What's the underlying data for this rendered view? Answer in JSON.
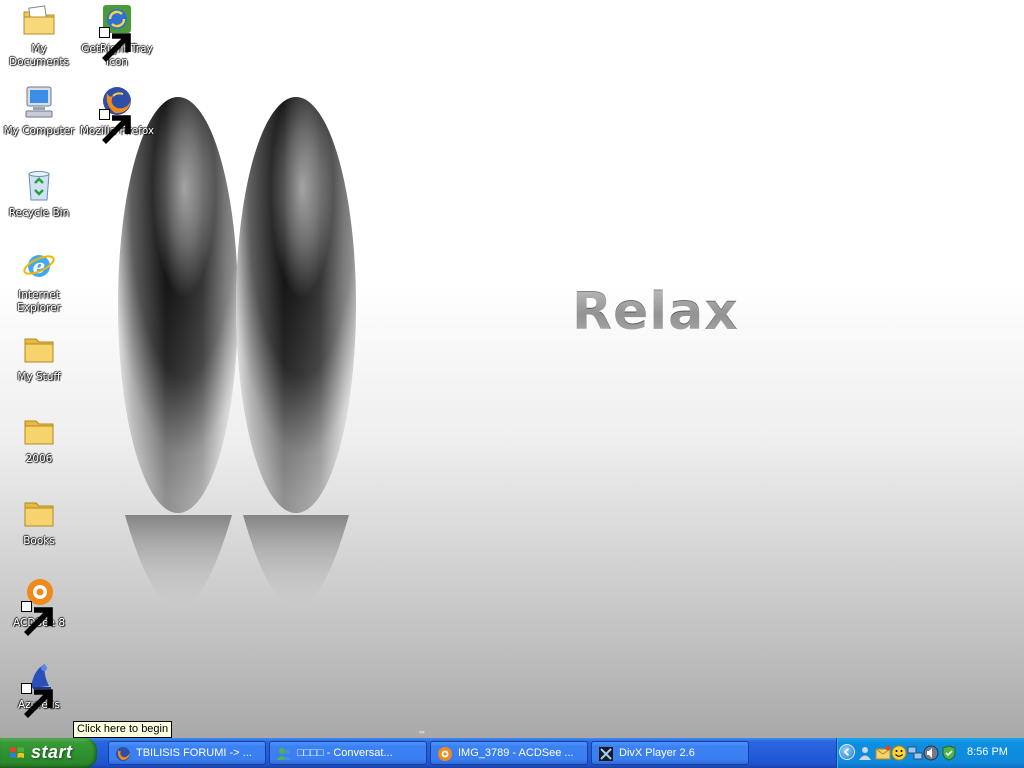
{
  "wallpaper": {
    "headline": "Relax",
    "brand": "",
    "brand_mark": "™"
  },
  "desktop_icons": [
    {
      "label": "My Documents",
      "icon": "my-documents-icon"
    },
    {
      "label": "GetRight Tray Icon",
      "icon": "getright-icon",
      "shortcut": true
    },
    {
      "label": "My Computer",
      "icon": "my-computer-icon"
    },
    {
      "label": "Mozilla Firefox",
      "icon": "firefox-icon",
      "shortcut": true
    },
    {
      "label": "Recycle Bin",
      "icon": "recycle-bin-icon"
    },
    {
      "label": "Internet Explorer",
      "icon": "internet-explorer-icon"
    },
    {
      "label": "My Stuff",
      "icon": "folder-icon"
    },
    {
      "label": "2006",
      "icon": "folder-icon"
    },
    {
      "label": "Books",
      "icon": "folder-icon"
    },
    {
      "label": "ACDSee 8",
      "icon": "acdsee-icon",
      "shortcut": true
    },
    {
      "label": "Azureus",
      "icon": "azureus-icon",
      "shortcut": true
    }
  ],
  "tooltip": {
    "text": "Click here to begin"
  },
  "taskbar": {
    "start_label": "start",
    "tasks": [
      {
        "label": "TBILISIS FORUMI -> ...",
        "icon": "firefox-icon"
      },
      {
        "label": "□□□□ - Conversat...",
        "icon": "messenger-icon"
      },
      {
        "label": "IMG_3789 - ACDSee ...",
        "icon": "acdsee-icon"
      },
      {
        "label": "DivX Player 2.6",
        "icon": "divx-icon"
      }
    ],
    "tray": {
      "icons": [
        "show-hidden-icons-chevron",
        "messenger-buddy-icon",
        "mail-icon",
        "smiley-icon",
        "network-icon",
        "speaker-icon",
        "security-icon"
      ],
      "clock": "8:56 PM"
    }
  },
  "colors": {
    "taskbar_blue": "#245edb",
    "start_green": "#2e8f2e",
    "tray_blue": "#0f89dc",
    "tooltip_bg": "#ffffe1"
  }
}
